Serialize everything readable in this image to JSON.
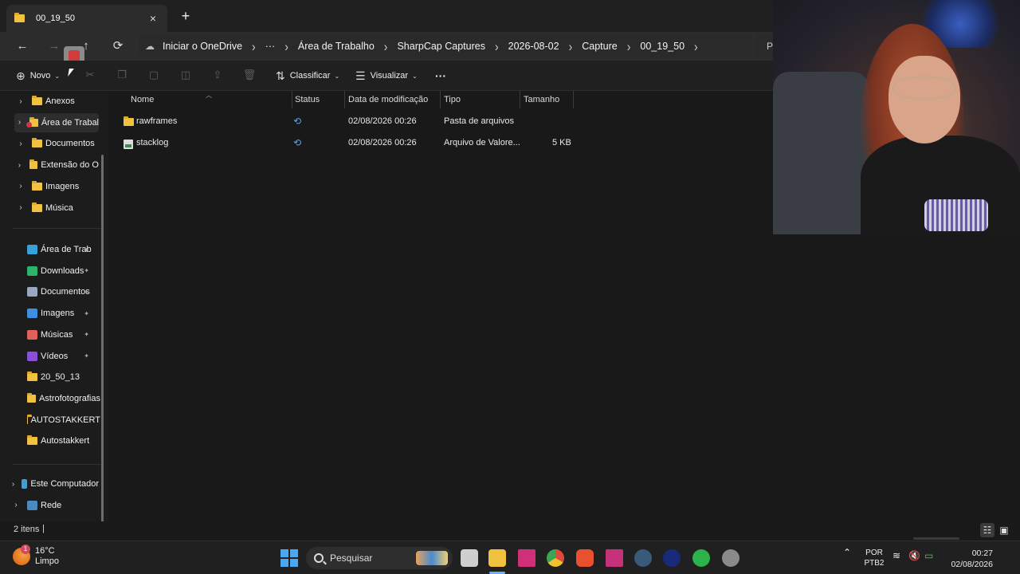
{
  "tab": {
    "title": "00_19_50",
    "close": "×",
    "new": "+"
  },
  "nav": {
    "back": "←",
    "forward": "→",
    "up": "↑",
    "refresh": "⟳",
    "breadcrumb": [
      "Iniciar o OneDrive",
      "···",
      "Área de Trabalho",
      "SharpCap Captures",
      "2026-08-02",
      "Capture",
      "00_19_50"
    ],
    "chevron": "›",
    "search_stub": "Pe"
  },
  "toolbar": {
    "new_label": "Novo",
    "sort_label": "Classificar",
    "view_label": "Visualizar",
    "more_label": "···"
  },
  "sidebar": {
    "tree": [
      {
        "label": "Anexos"
      },
      {
        "label": "Área de Trabal"
      },
      {
        "label": "Documentos"
      },
      {
        "label": "Extensão do O"
      },
      {
        "label": "Imagens"
      },
      {
        "label": "Música"
      }
    ],
    "quick": [
      {
        "label": "Área de Trab",
        "icon": "desktop-icon",
        "color": "#3aa0d8",
        "pinned": true
      },
      {
        "label": "Downloads",
        "icon": "download-icon",
        "color": "#2fb36a",
        "pinned": true
      },
      {
        "label": "Documentos",
        "icon": "document-icon",
        "color": "#9aa7c0",
        "pinned": true
      },
      {
        "label": "Imagens",
        "icon": "image-icon",
        "color": "#3f8fe0",
        "pinned": true
      },
      {
        "label": "Músicas",
        "icon": "music-icon",
        "color": "#e0605a",
        "pinned": true
      },
      {
        "label": "Vídeos",
        "icon": "video-icon",
        "color": "#8a4fd8",
        "pinned": true
      },
      {
        "label": "20_50_13",
        "icon": "folder-icon",
        "color": "#f1c140",
        "pinned": false
      },
      {
        "label": "Astrofotografias",
        "icon": "folder-icon",
        "color": "#f1c140",
        "pinned": false
      },
      {
        "label": "AUTOSTAKKERT",
        "icon": "folder-icon",
        "color": "#f1c140",
        "pinned": false
      },
      {
        "label": "Autostakkert",
        "icon": "folder-icon",
        "color": "#f1c140",
        "pinned": false
      }
    ],
    "bottom": [
      {
        "label": "Este Computador"
      },
      {
        "label": "Rede"
      }
    ],
    "pin_glyph": "📌"
  },
  "columns": {
    "name": "Nome",
    "status": "Status",
    "modified": "Data de modificação",
    "type": "Tipo",
    "size": "Tamanho"
  },
  "files": [
    {
      "name": "rawframes",
      "modified": "02/08/2026 00:26",
      "type": "Pasta de arquivos",
      "size": "",
      "icon": "folder-icon"
    },
    {
      "name": "stacklog",
      "modified": "02/08/2026 00:26",
      "type": "Arquivo de Valore...",
      "size": "5 KB",
      "icon": "csv-file-icon"
    }
  ],
  "status": {
    "count": "2 itens"
  },
  "taskbar": {
    "weather_badge": "1",
    "temperature": "16°C",
    "condition": "Limpo",
    "search_label": "Pesquisar",
    "lang1": "POR",
    "lang2": "PTB2",
    "time": "00:27",
    "date": "02/08/2026"
  }
}
